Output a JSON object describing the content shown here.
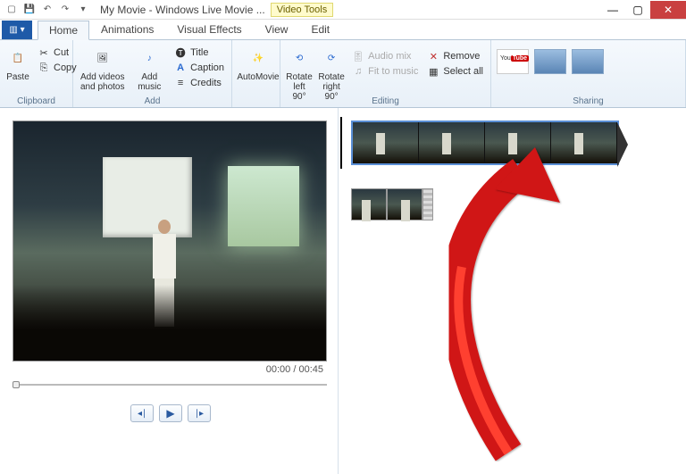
{
  "title": "My Movie - Windows Live Movie ...",
  "contextual_tab": "Video Tools",
  "tabs": {
    "home": "Home",
    "animations": "Animations",
    "visual_effects": "Visual Effects",
    "view": "View",
    "edit": "Edit"
  },
  "ribbon": {
    "clipboard": {
      "label": "Clipboard",
      "paste": "Paste",
      "cut": "Cut",
      "copy": "Copy"
    },
    "add": {
      "label": "Add",
      "add_videos": "Add videos\nand photos",
      "add_music": "Add\nmusic",
      "title": "Title",
      "caption": "Caption",
      "credits": "Credits"
    },
    "automovie": "AutoMovie",
    "editing": {
      "label": "Editing",
      "rotate_left": "Rotate\nleft 90°",
      "rotate_right": "Rotate\nright 90°",
      "audio_mix": "Audio mix",
      "fit_to_music": "Fit to music",
      "remove": "Remove",
      "select_all": "Select all"
    },
    "sharing": {
      "label": "Sharing"
    }
  },
  "preview": {
    "current": "00:00",
    "total": "00:45"
  }
}
